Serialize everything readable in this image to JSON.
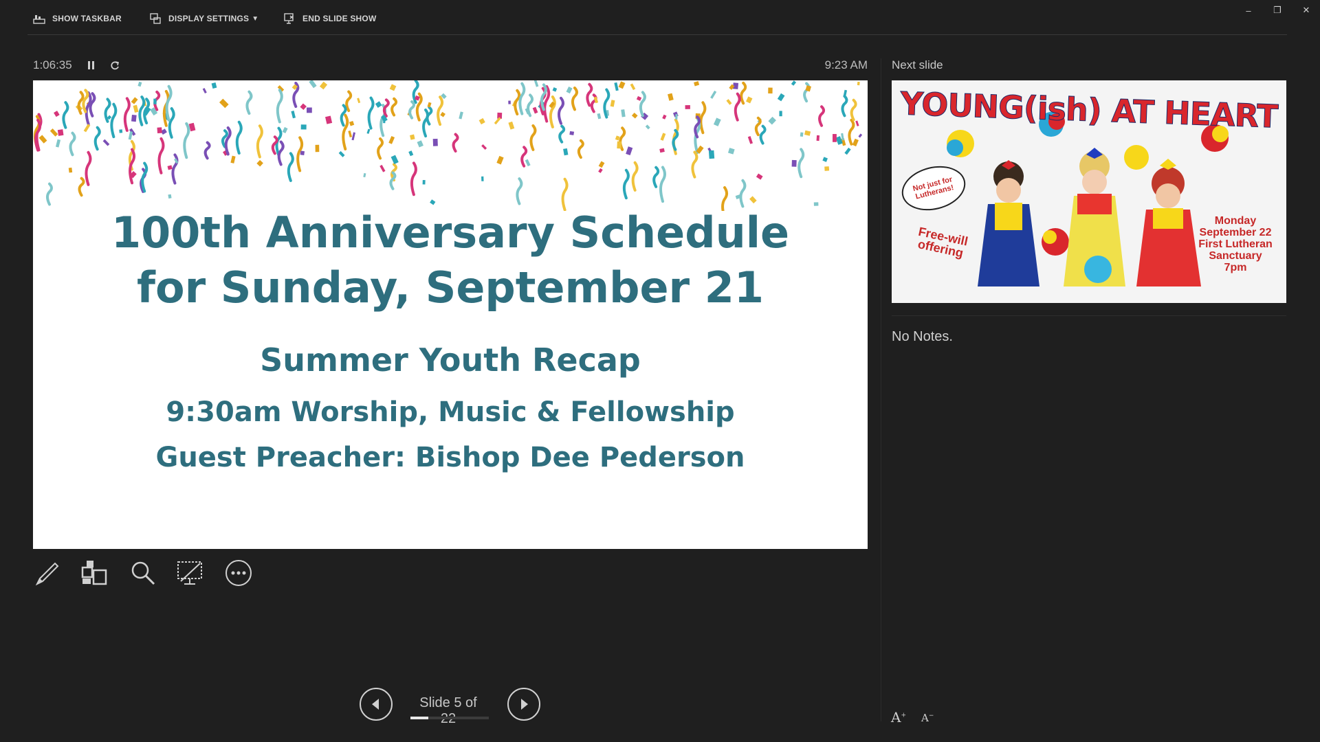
{
  "toolbar": {
    "show_taskbar": "SHOW TASKBAR",
    "display_settings": "DISPLAY SETTINGS",
    "end_slide_show": "END SLIDE SHOW"
  },
  "window_controls": {
    "minimize": "–",
    "restore": "❐",
    "close": "✕"
  },
  "timer": {
    "elapsed": "1:06:35",
    "clock": "9:23 AM"
  },
  "current_slide": {
    "title_line1": "100th Anniversary Schedule",
    "title_line2": "for Sunday, September 21",
    "subtitle": "Summer Youth Recap",
    "line1": "9:30am Worship, Music & Fellowship",
    "line2": "Guest Preacher: Bishop Dee Pederson"
  },
  "navigation": {
    "counter": "Slide 5 of 22",
    "current": 5,
    "total": 22
  },
  "right_pane": {
    "next_label": "Next slide",
    "next_slide": {
      "title": "YOUNG(ish) AT HEART",
      "bubble": "Not just for Lutherans!",
      "offering": "Free-will offering",
      "event_lines": [
        "Monday",
        "September 22",
        "First Lutheran",
        "Sanctuary",
        "7pm"
      ]
    },
    "notes": "No Notes."
  },
  "font_controls": {
    "increase": "A",
    "decrease": "A"
  },
  "colors": {
    "slide_text": "#2e6e7e",
    "next_slide_red": "#d9262c",
    "background": "#1f1f1f"
  },
  "icons": [
    "pen-icon",
    "slides-grid-icon",
    "zoom-icon",
    "black-screen-icon",
    "more-options-icon"
  ]
}
